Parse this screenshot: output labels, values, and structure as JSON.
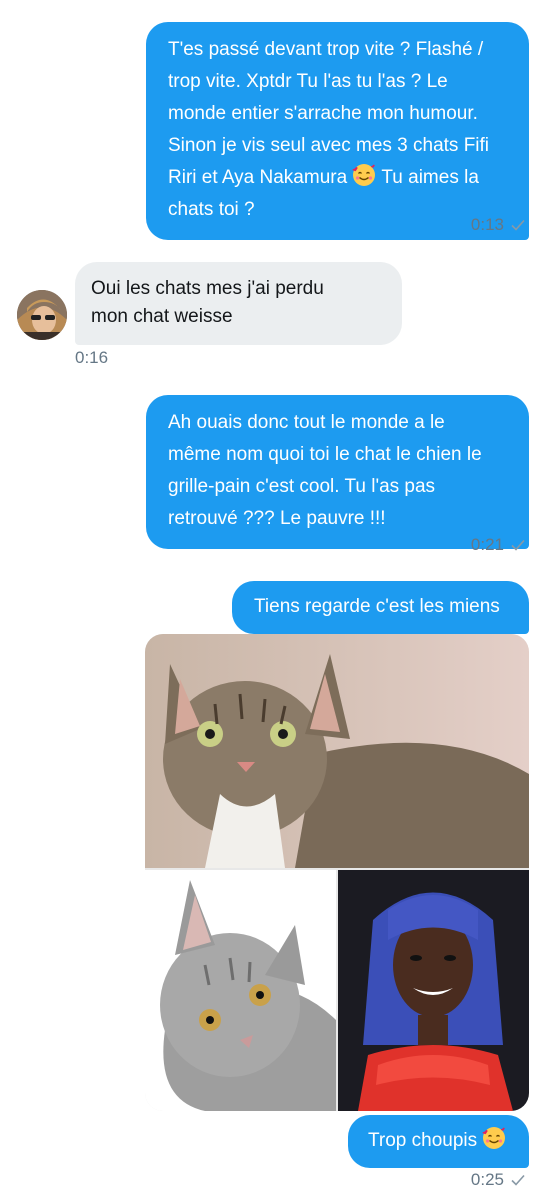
{
  "messages": [
    {
      "direction": "outgoing",
      "lines": [
        "T'es passé devant trop vite ? Flashé /",
        "trop vite. Xptdr Tu l'as tu l'as ? Le",
        "monde entier s'arrache mon humour.",
        "Sinon je vis seul avec mes 3 chats Fifi"
      ],
      "last_line_before_emoji": "Riri et Aya Nakamura",
      "last_line_after_emoji": "Tu aimes la",
      "final_line": "chats toi ?",
      "emoji": "smiling-face-with-hearts",
      "time": "0:13"
    },
    {
      "direction": "incoming",
      "lines": [
        "Oui les chats mes j'ai perdu",
        "mon chat weisse"
      ],
      "time": "0:16"
    },
    {
      "direction": "outgoing",
      "lines": [
        "Ah ouais donc tout le monde a le",
        "même nom quoi toi le chat le chien le",
        "grille-pain c'est cool. Tu l'as pas",
        "retrouvé ??? Le pauvre !!!"
      ],
      "time": "0:21"
    },
    {
      "direction": "outgoing",
      "lines": [
        "Tiens regarde c'est les miens"
      ]
    },
    {
      "direction": "outgoing",
      "text": "Trop choupis",
      "emoji": "smiling-face-with-hearts",
      "time": "0:25"
    }
  ],
  "media": [
    {
      "subject": "tabby-cat-photo"
    },
    {
      "subject": "grey-cat-photo"
    },
    {
      "subject": "woman-blue-hair-photo"
    }
  ],
  "colors": {
    "outgoing_bubble": "#1d9bf0",
    "incoming_bubble": "#ebeef0",
    "timestamp": "#657786"
  }
}
